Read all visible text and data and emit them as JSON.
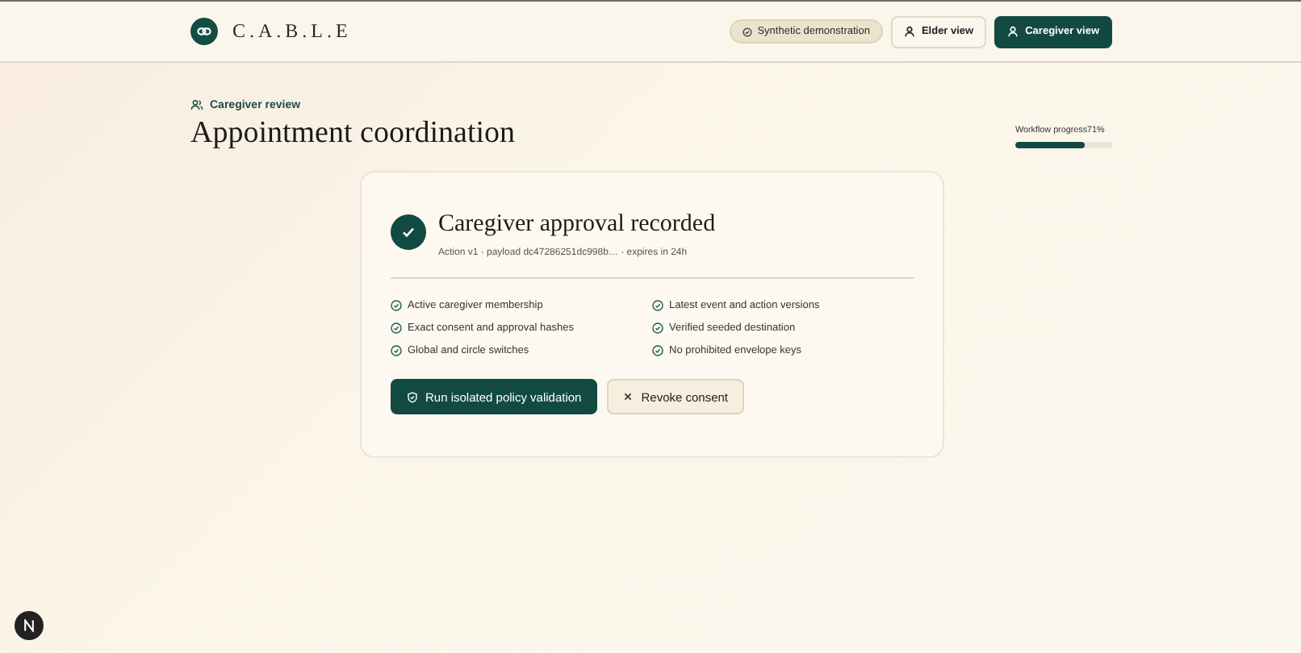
{
  "header": {
    "brand": "C.A.B.L.E",
    "badge": "Synthetic demonstration",
    "views": [
      {
        "label": "Elder view",
        "selected": false
      },
      {
        "label": "Caregiver view",
        "selected": true
      }
    ]
  },
  "page": {
    "eyebrow": "Caregiver review",
    "title": "Appointment coordination",
    "progress": {
      "label": "Workflow progress",
      "reading": "71%",
      "level": 0.71
    }
  },
  "card": {
    "title": "Caregiver approval recorded",
    "meta": "Action v1 · payload dc47286251dc998b… · expires in 24h",
    "checks": [
      {
        "label": "Active caregiver membership",
        "checked": true
      },
      {
        "label": "Latest event and action versions",
        "checked": true
      },
      {
        "label": "Exact consent and approval hashes",
        "checked": true
      },
      {
        "label": "Verified seeded destination",
        "checked": true
      },
      {
        "label": "Global and circle switches",
        "checked": true
      },
      {
        "label": "No prohibited envelope keys",
        "checked": true
      }
    ],
    "buttons": [
      {
        "label": "Run isolated policy validation",
        "kind": "primary"
      },
      {
        "label": "Revoke consent",
        "kind": "secondary"
      }
    ]
  }
}
